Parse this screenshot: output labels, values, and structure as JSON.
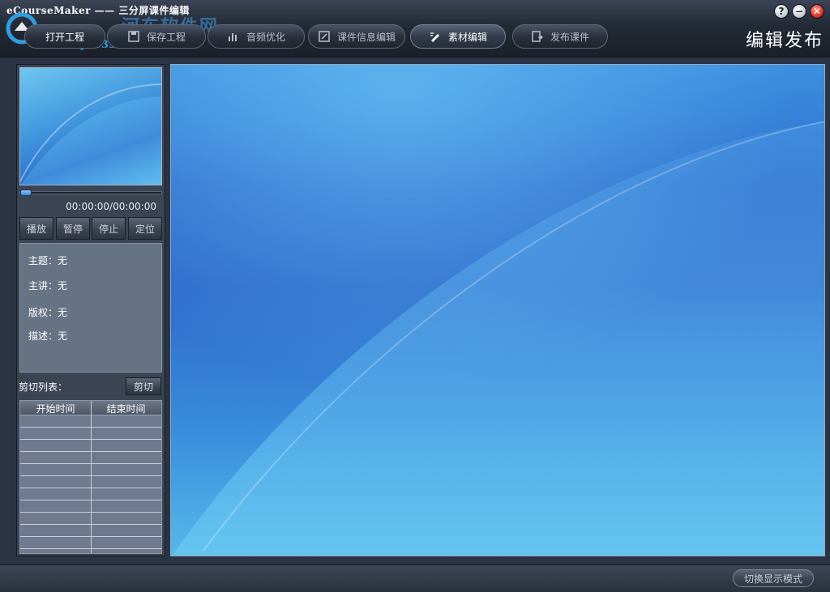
{
  "window": {
    "title": "eCourseMaker —— 三分屏课件编辑",
    "mode_title": "编辑发布",
    "watermark_name": "河东软件网",
    "watermark_url": "www.pc0359.cn",
    "help_label": "?",
    "minimize_label": "−",
    "close_label": "✕"
  },
  "toolbar": {
    "buttons": [
      {
        "label": "打开工程",
        "icon": "open-project-icon"
      },
      {
        "label": "保存工程",
        "icon": "save-icon"
      },
      {
        "label": "音频优化",
        "icon": "equalizer-icon"
      },
      {
        "label": "课件信息编辑",
        "icon": "edit-info-icon"
      },
      {
        "label": "素材编辑",
        "icon": "material-edit-icon"
      },
      {
        "label": "发布课件",
        "icon": "publish-icon"
      }
    ],
    "active_index": 4
  },
  "player": {
    "time": "00:00:00/00:00:00",
    "progress": 0,
    "buttons": {
      "play": "播放",
      "pause": "暂停",
      "stop": "停止",
      "locate": "定位"
    }
  },
  "info": {
    "topic": "主题：无",
    "speaker": "主讲：无",
    "copyright": "版权：无",
    "description": "描述：无"
  },
  "cut": {
    "label": "剪切列表：",
    "button": "剪切",
    "columns": [
      "开始时间",
      "结束时间"
    ],
    "rows": []
  },
  "statusbar": {
    "toggle_label": "切换显示模式"
  },
  "colors": {
    "stage_blue": "#2e6fd0",
    "panel_gray": "#667384",
    "toolbar_dark": "#232a36"
  }
}
